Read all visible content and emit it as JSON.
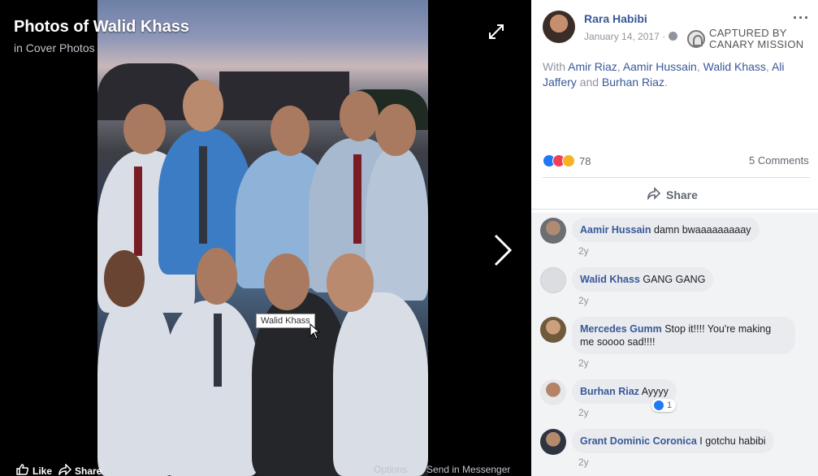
{
  "theater": {
    "title": "Photos of Walid Khass",
    "subtitle": "in Cover Photos",
    "photo_tag": "Walid Khass",
    "bottom": {
      "like": "Like",
      "share": "Share",
      "options": "Options",
      "send": "Send in Messenger"
    }
  },
  "post": {
    "author": "Rara Habibi",
    "date": "January 14, 2017 ·",
    "with_prefix": "With ",
    "tagged": [
      "Amir Riaz",
      "Aamir Hussain",
      "Walid Khass",
      "Ali Jaffery",
      "Burhan Riaz"
    ],
    "with_sep1": ", ",
    "with_and": " and ",
    "with_end": ".",
    "reaction_count": "78",
    "comment_count": "5 Comments",
    "share_label": "Share",
    "more": "···"
  },
  "watermark": {
    "line1": "CAPTURED BY",
    "line2": "CANARY MISSION"
  },
  "comments": [
    {
      "name": "Aamir Hussain",
      "text": "damn bwaaaaaaaaay",
      "time": "2y"
    },
    {
      "name": "Walid Khass",
      "text": "GANG GANG",
      "time": "2y"
    },
    {
      "name": "Mercedes Gumm",
      "text": "Stop it!!!! You're making me soooo sad!!!!",
      "time": "2y"
    },
    {
      "name": "Burhan Riaz",
      "text": "Ayyyy",
      "time": "2y",
      "likes": "1"
    },
    {
      "name": "Grant Dominic Coronica",
      "text": "I gotchu habibi",
      "time": "2y"
    }
  ],
  "colors": {
    "link": "#385898",
    "like_blue": "#2078f4",
    "love_red": "#f33e58",
    "sad_yellow": "#f7b125"
  }
}
